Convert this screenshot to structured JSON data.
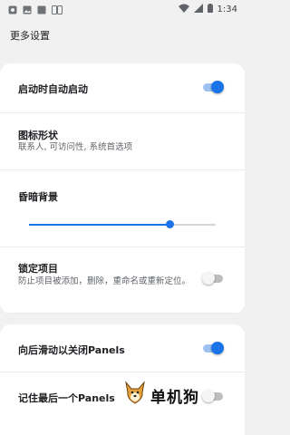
{
  "status_bar": {
    "time": "1:34",
    "left_icons": [
      "gear-icon",
      "image-icon",
      "square-icon",
      "sim-card-icon"
    ],
    "right_icons": [
      "wifi-icon",
      "signal-icon",
      "battery-icon"
    ]
  },
  "page": {
    "title": "更多设置"
  },
  "settings": {
    "autostart": {
      "label": "启动时自动启动",
      "enabled": true
    },
    "icon_shape": {
      "label": "图标形状",
      "summary": "联系人, 可访问性, 系统首选项"
    },
    "dim_background": {
      "label": "昏暗背景",
      "value": 0.75
    },
    "lock_items": {
      "label": "锁定项目",
      "summary": "防止项目被添加，删除，重命名或重新定位。",
      "enabled": false
    },
    "swipe_back_close": {
      "label": "向后滑动以关闭Panels",
      "enabled": true
    },
    "remember_last": {
      "label": "记住最后一个Panels",
      "enabled": false
    }
  },
  "watermark": {
    "text": "单机狗"
  },
  "colors": {
    "accent": "#1a73e8",
    "accent_light": "#9ec2ef",
    "background": "#f1f1f1",
    "card": "#ffffff"
  }
}
